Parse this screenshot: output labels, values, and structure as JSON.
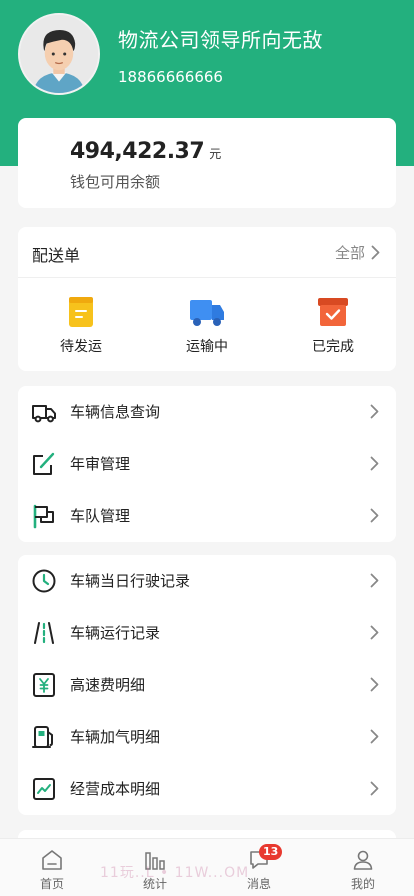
{
  "colors": {
    "brand": "#23b07e",
    "badge": "#e8392f"
  },
  "profile": {
    "name": "物流公司领导所向无敌",
    "phone": "18866666666",
    "avatar_icon": "user-avatar-cartoon"
  },
  "wallet": {
    "balance": "494,422.37",
    "unit": "元",
    "label": "钱包可用余额"
  },
  "delivery": {
    "title": "配送单",
    "all_label": "全部",
    "statuses": [
      {
        "label": "待发运",
        "icon": "clipboard-icon",
        "color": "#f7c21c"
      },
      {
        "label": "运输中",
        "icon": "truck-icon",
        "color": "#3f8ff2"
      },
      {
        "label": "已完成",
        "icon": "box-check-icon",
        "color": "#f2653a"
      }
    ]
  },
  "menu1": [
    {
      "label": "车辆信息查询",
      "icon": "truck-outline-icon"
    },
    {
      "label": "年审管理",
      "icon": "edit-icon"
    },
    {
      "label": "车队管理",
      "icon": "fleet-icon"
    }
  ],
  "menu2": [
    {
      "label": "车辆当日行驶记录",
      "icon": "clock-icon"
    },
    {
      "label": "车辆运行记录",
      "icon": "road-icon"
    },
    {
      "label": "高速费明细",
      "icon": "yuan-icon"
    },
    {
      "label": "车辆加气明细",
      "icon": "gas-station-icon"
    },
    {
      "label": "经营成本明细",
      "icon": "trend-chart-icon"
    }
  ],
  "tabbar": {
    "items": [
      {
        "label": "首页",
        "icon": "home-icon"
      },
      {
        "label": "统计",
        "icon": "bar-chart-icon"
      },
      {
        "label": "消息",
        "icon": "message-icon",
        "badge": "13"
      },
      {
        "label": "我的",
        "icon": "person-icon"
      }
    ]
  },
  "watermark": "11玩..L • 11W...OM"
}
